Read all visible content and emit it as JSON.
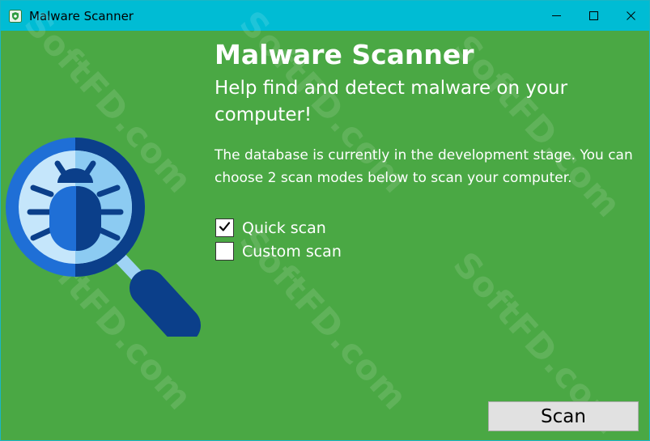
{
  "window": {
    "title": "Malware Scanner",
    "controls": {
      "minimize": "minimize-icon",
      "maximize": "maximize-icon",
      "close": "close-icon"
    }
  },
  "main": {
    "heading": "Malware Scanner",
    "subheading": "Help find and detect malware on your computer!",
    "description": "The database is currently in the development stage. You can choose 2 scan modes below to scan your computer."
  },
  "options": [
    {
      "label": "Quick scan",
      "checked": true
    },
    {
      "label": "Custom scan",
      "checked": false
    }
  ],
  "scan_button": {
    "label": "Scan"
  },
  "watermark": "SoftFD.com",
  "icons": {
    "app": "shield-bug-icon",
    "hero": "bug-magnifier-icon",
    "check": "check-icon"
  },
  "colors": {
    "background": "#4aa844",
    "titlebar": "#00bcd4",
    "text": "#ffffff",
    "button": "#e1e1e1",
    "icon_dark": "#0b3f8a",
    "icon_mid": "#1f6fd6",
    "icon_light": "#9fd3f5"
  }
}
